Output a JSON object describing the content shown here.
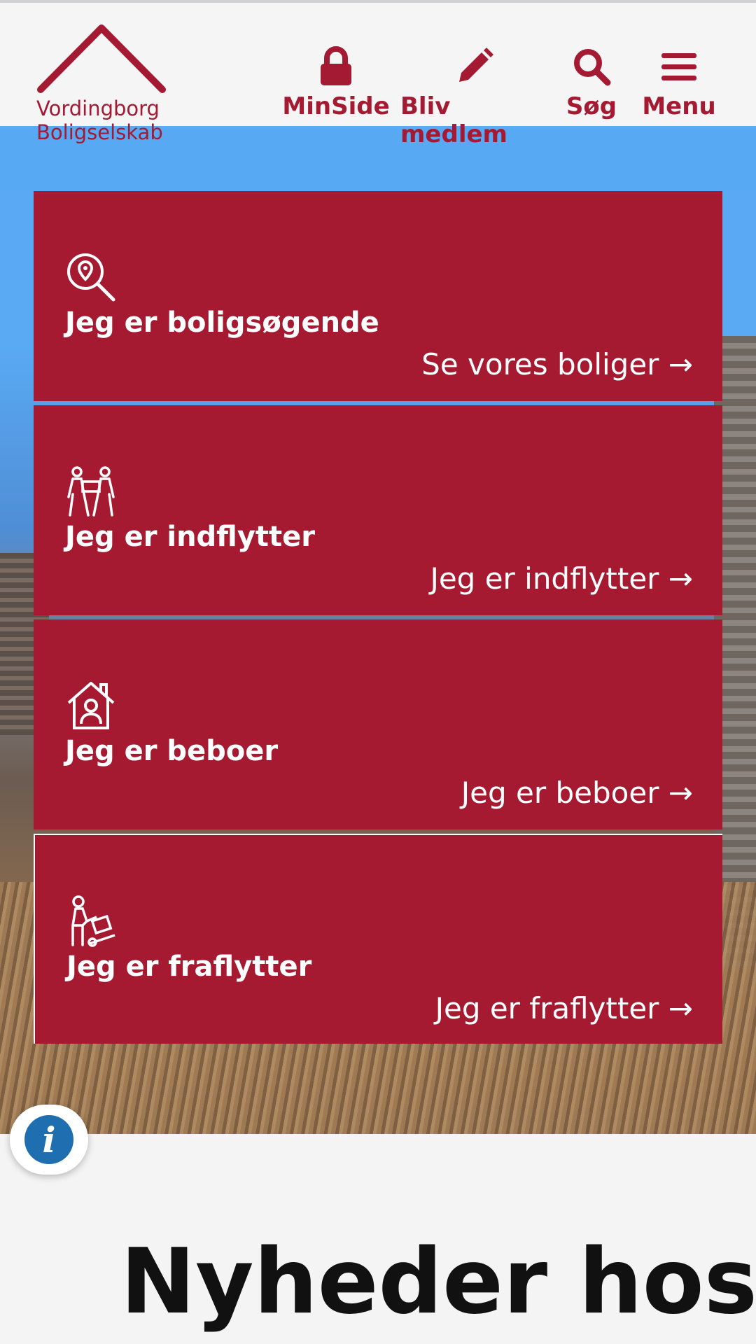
{
  "brand": {
    "line1": "Vordingborg",
    "line2": "Boligselskab",
    "color": "#a51a33"
  },
  "nav": {
    "minside": "MinSide",
    "bliv": "Bliv medlem",
    "sog": "Søg",
    "menu": "Menu"
  },
  "cards": [
    {
      "icon": "location-search-icon",
      "title": "Jeg er boligsøgende",
      "link": "Se vores boliger →"
    },
    {
      "icon": "movers-icon",
      "title": "Jeg er indflytter",
      "link": "Jeg er indflytter →"
    },
    {
      "icon": "house-person-icon",
      "title": "Jeg er beboer",
      "link": "Jeg er beboer →"
    },
    {
      "icon": "person-trolley-icon",
      "title": "Jeg er fraflytter",
      "link": "Jeg er fraflytter →"
    }
  ],
  "info": {
    "label": "i"
  },
  "news": {
    "title": "Nyheder hos"
  },
  "colors": {
    "accent": "#a51a31",
    "info": "#1f6fb0"
  }
}
